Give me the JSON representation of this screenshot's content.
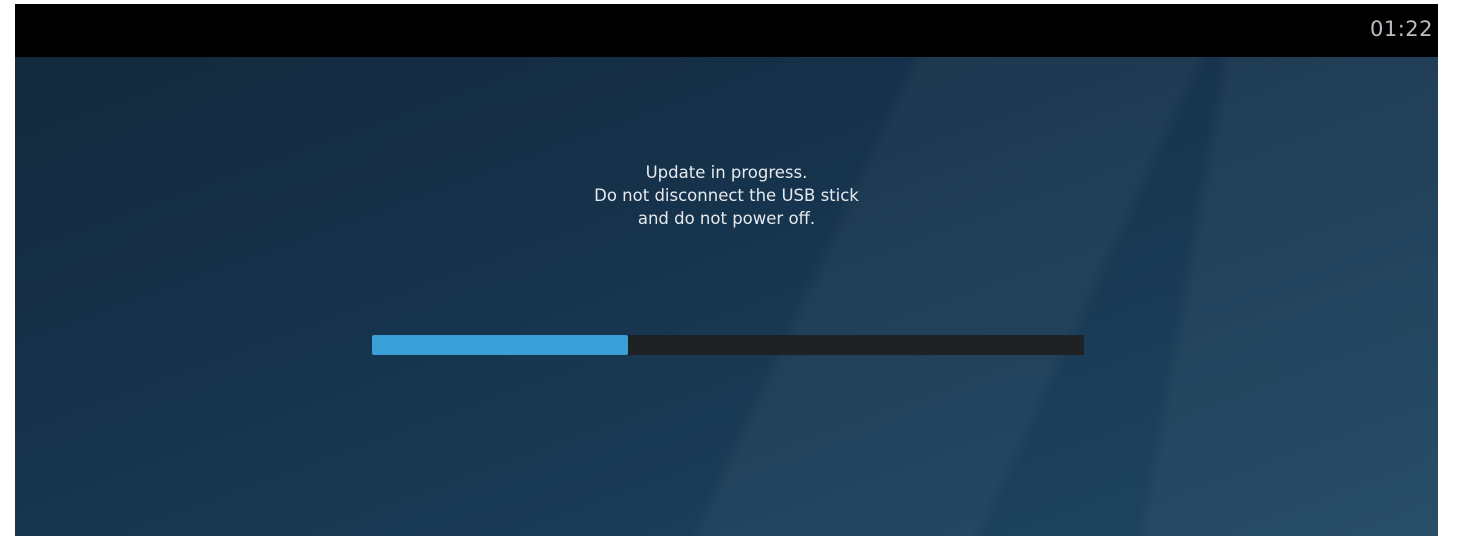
{
  "status_bar": {
    "clock": "01:22"
  },
  "update": {
    "message_lines": [
      "Update in progress.",
      "Do not disconnect the USB stick",
      "and do not power off."
    ],
    "progress_fraction": 0.36,
    "colors": {
      "accent": "#3a9fd6",
      "track": "#1f2224"
    }
  }
}
